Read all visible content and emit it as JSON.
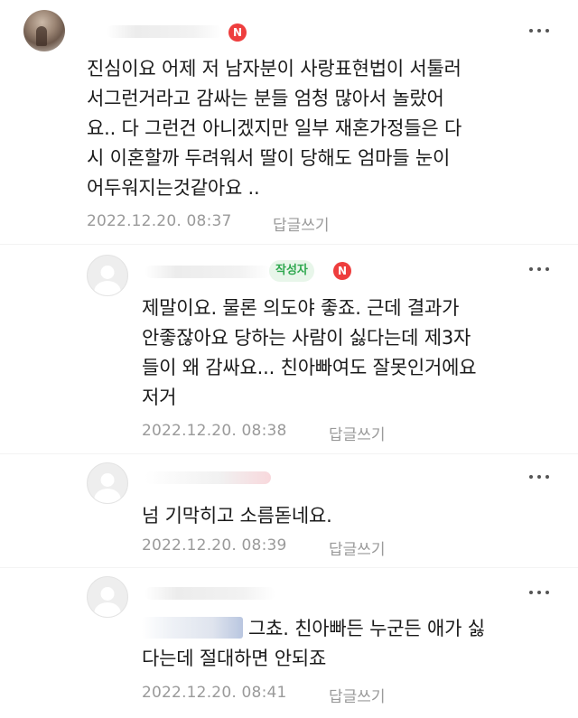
{
  "badges": {
    "new": "N",
    "author": "작성자"
  },
  "actions": {
    "reply": "답글쓰기"
  },
  "comments": [
    {
      "text": "진심이요 어제 저 남자분이 사랑표현법이 서툴러\n서그런거라고 감싸는 분들 엄청 많아서 놀랐어\n요.. 다 그런건 아니겠지만 일부 재혼가정들은 다\n시 이혼할까 두려워서 딸이 당해도 엄마들 눈이\n어두워지는것같아요 ..",
      "date": "2022.12.20. 08:37"
    },
    {
      "text": "제말이요. 물론 의도야 좋죠. 근데 결과가\n안좋잖아요 당하는 사람이 싫다는데 제3자\n들이 왜 감싸요... 친아빠여도 잘못인거에요\n저거",
      "date": "2022.12.20. 08:38"
    },
    {
      "text": "넘 기막히고 소름돋네요.",
      "date": "2022.12.20. 08:39"
    },
    {
      "text_line1": "그쵸. 친아빠든 누군든 애가 싫",
      "text_line2": "다는데 절대하면 안되죠",
      "date": "2022.12.20. 08:41"
    }
  ],
  "colors": {
    "new_badge": "#ee3e3e",
    "author_badge_bg": "#e8f6ea",
    "author_badge_text": "#2fa84f",
    "meta_text": "#9a9a9a"
  },
  "icons": {
    "more": "more-dots-icon",
    "avatar_default": "default-avatar-icon"
  }
}
